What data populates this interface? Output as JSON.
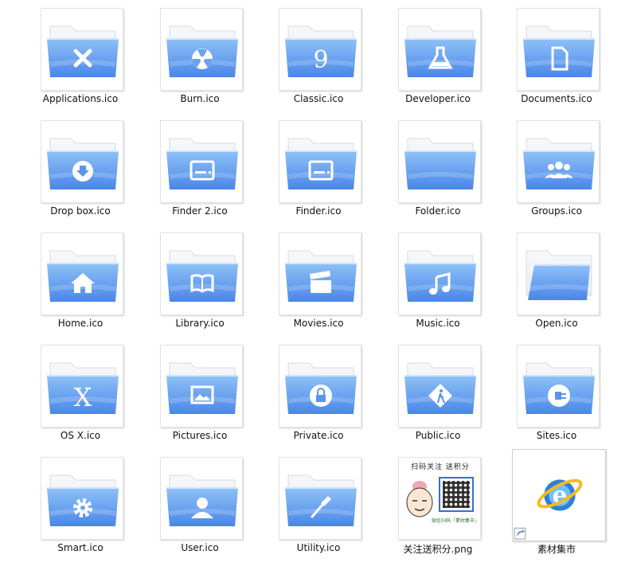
{
  "files": [
    {
      "name": "Applications.ico",
      "icon": "applications-tools-icon"
    },
    {
      "name": "Burn.ico",
      "icon": "burn-radiation-icon"
    },
    {
      "name": "Classic.ico",
      "icon": "classic-9-icon"
    },
    {
      "name": "Developer.ico",
      "icon": "developer-flask-icon"
    },
    {
      "name": "Documents.ico",
      "icon": "documents-page-icon"
    },
    {
      "name": "Drop box.ico",
      "icon": "dropbox-download-icon"
    },
    {
      "name": "Finder 2.ico",
      "icon": "finder-drive-icon"
    },
    {
      "name": "Finder.ico",
      "icon": "finder-drive-icon"
    },
    {
      "name": "Folder.ico",
      "icon": "plain-folder-icon"
    },
    {
      "name": "Groups.ico",
      "icon": "groups-people-icon"
    },
    {
      "name": "Home.ico",
      "icon": "home-house-icon"
    },
    {
      "name": "Library.ico",
      "icon": "library-book-icon"
    },
    {
      "name": "Movies.ico",
      "icon": "movies-clapper-icon"
    },
    {
      "name": "Music.ico",
      "icon": "music-note-icon"
    },
    {
      "name": "Open.ico",
      "icon": "open-folder-icon"
    },
    {
      "name": "OS X.ico",
      "icon": "osx-x-icon"
    },
    {
      "name": "Pictures.ico",
      "icon": "pictures-image-icon"
    },
    {
      "name": "Private.ico",
      "icon": "private-lock-icon"
    },
    {
      "name": "Public.ico",
      "icon": "public-sign-icon"
    },
    {
      "name": "Sites.ico",
      "icon": "sites-plug-icon"
    },
    {
      "name": "Smart.ico",
      "icon": "smart-gear-icon"
    },
    {
      "name": "User.ico",
      "icon": "user-person-icon"
    },
    {
      "name": "Utility.ico",
      "icon": "utility-screwdriver-icon"
    },
    {
      "name": "关注送积分.png",
      "icon": "qr-promo-image",
      "png_title": "扫码关注 送积分",
      "png_foot": "微信扫码「素材集市」"
    },
    {
      "name": "素材集市",
      "icon": "ie-shortcut-icon"
    }
  ],
  "colors": {
    "folder_front_top": "#8ec1f7",
    "folder_front_bottom": "#4a86e8",
    "folder_back": "#e8ebf0",
    "glyph": "#ffffff"
  }
}
